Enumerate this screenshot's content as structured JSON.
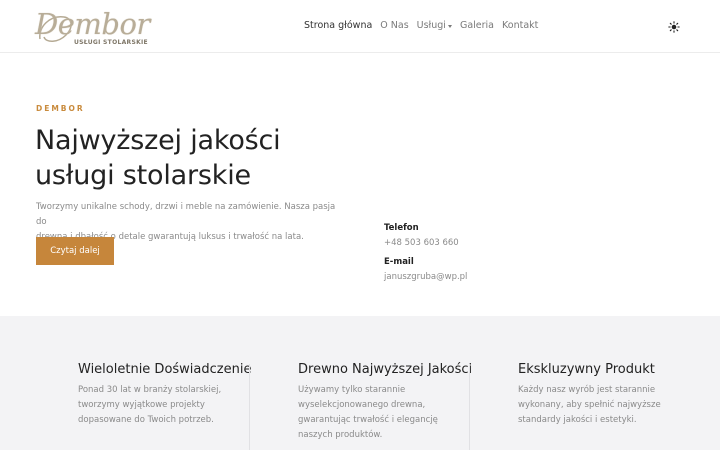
{
  "header": {
    "logo": {
      "script": "Dembor",
      "subtitle": "USŁUGI STOLARSKIE"
    },
    "nav": [
      {
        "label": "Strona główna",
        "active": true
      },
      {
        "label": "O Nas"
      },
      {
        "label": "Usługi",
        "dropdown": true
      },
      {
        "label": "Galeria"
      },
      {
        "label": "Kontakt"
      }
    ],
    "theme_icon": "sun-icon"
  },
  "hero": {
    "eyebrow": "DEMBOR",
    "title_line1": "Najwyższej jakości",
    "title_line2": "usługi stolarskie",
    "desc_line1": "Tworzymy unikalne schody, drzwi i meble na zamówienie. Nasza pasja do",
    "desc_line2": "drewna i dbałość o detale gwarantują luksus i trwałość na lata.",
    "cta": "Czytaj dalej"
  },
  "contact": {
    "phone_label": "Telefon",
    "phone": "+48 503 603 660",
    "email_label": "E-mail",
    "email": "januszgruba@wp.pl"
  },
  "features": [
    {
      "title": "Wieloletnie Doświadczenie",
      "lines": [
        "Ponad 30 lat w branży stolarskiej,",
        "tworzymy wyjątkowe projekty",
        "dopasowane do Twoich potrzeb."
      ]
    },
    {
      "title": "Drewno Najwyższej Jakości",
      "lines": [
        "Używamy tylko starannie",
        "wyselekcjonowanego drewna,",
        "gwarantując trwałość i elegancję",
        "naszych produktów."
      ]
    },
    {
      "title": "Ekskluzywny Produkt",
      "lines": [
        "Każdy nasz wyrób jest starannie",
        "wykonany, aby spełnić najwyższe",
        "standardy jakości i estetyki."
      ]
    }
  ],
  "colors": {
    "accent": "#c6863b",
    "eyebrow": "#c98b3d",
    "features_bg": "#f3f3f5"
  }
}
